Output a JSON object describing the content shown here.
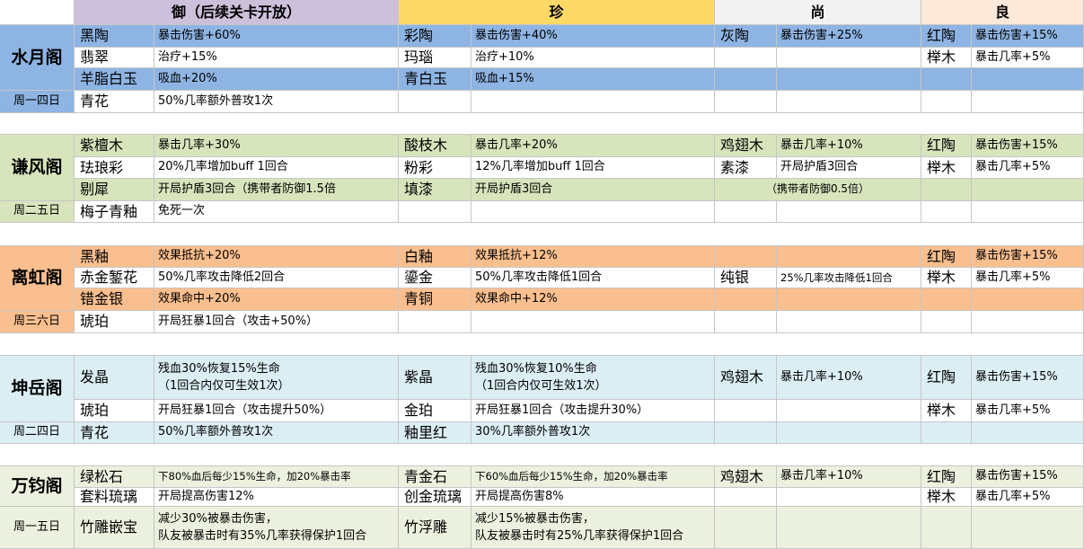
{
  "headers": {
    "yu": "御（后续关卡开放）",
    "zhen": "珍",
    "shang": "尚",
    "liang": "良"
  },
  "colors": {
    "blue_row": "#8eb4e3",
    "green_row": "#d8e4bc",
    "orange_row": "#fabf8f",
    "lightblue_row": "#dbeef4",
    "beige_row": "#ebf1de",
    "yu_header": "#ccc0da",
    "zhen_header": "#ffd966",
    "shang_header": "#f2f2f2",
    "liang_header": "#fde9d9"
  },
  "groups": [
    {
      "name": "水月阁",
      "days": "周一四日",
      "rows": [
        {
          "yu_item": "黑陶",
          "yu_effect": "暴击伤害+60%",
          "zhen_item": "彩陶",
          "zhen_effect": "暴击伤害+40%",
          "shang_item": "灰陶",
          "shang_effect": "暴击伤害+25%",
          "liang_item": "红陶",
          "liang_effect": "暴击伤害+15%"
        },
        {
          "yu_item": "翡翠",
          "yu_effect": "治疗+15%",
          "zhen_item": "玛瑙",
          "zhen_effect": "治疗+10%",
          "shang_item": "",
          "shang_effect": "",
          "liang_item": "榉木",
          "liang_effect": "暴击几率+5%"
        },
        {
          "yu_item": "羊脂白玉",
          "yu_effect": "吸血+20%",
          "zhen_item": "青白玉",
          "zhen_effect": "吸血+15%",
          "shang_item": "",
          "shang_effect": "",
          "liang_item": "",
          "liang_effect": ""
        },
        {
          "yu_item": "青花",
          "yu_effect": "50%几率额外普攻1次",
          "zhen_item": "",
          "zhen_effect": "",
          "shang_item": "",
          "shang_effect": "",
          "liang_item": "",
          "liang_effect": ""
        }
      ]
    },
    {
      "name": "谦风阁",
      "days": "周二五日",
      "rows": [
        {
          "yu_item": "紫檀木",
          "yu_effect": "暴击几率+30%",
          "zhen_item": "酸枝木",
          "zhen_effect": "暴击几率+20%",
          "shang_item": "鸡翅木",
          "shang_effect": "暴击几率+10%",
          "liang_item": "红陶",
          "liang_effect": "暴击伤害+15%"
        },
        {
          "yu_item": "珐琅彩",
          "yu_effect": "20%几率增加buff 1回合",
          "zhen_item": "粉彩",
          "zhen_effect": "12%几率增加buff 1回合",
          "shang_item": "素漆",
          "shang_effect": "开局护盾3回合",
          "liang_item": "榉木",
          "liang_effect": "暴击几率+5%"
        },
        {
          "yu_item": "剔犀",
          "yu_effect": "开局护盾3回合（携带者防御1.5倍",
          "zhen_item": "填漆",
          "zhen_effect": "开局护盾3回合",
          "shang_item": "",
          "shang_effect": "（携带者防御0.5倍）",
          "liang_item": "",
          "liang_effect": ""
        },
        {
          "yu_item": "梅子青釉",
          "yu_effect": "免死一次",
          "zhen_item": "",
          "zhen_effect": "",
          "shang_item": "",
          "shang_effect": "",
          "liang_item": "",
          "liang_effect": ""
        }
      ]
    },
    {
      "name": "离虹阁",
      "days": "周三六日",
      "rows": [
        {
          "yu_item": "黑釉",
          "yu_effect": "效果抵抗+20%",
          "zhen_item": "白釉",
          "zhen_effect": "效果抵抗+12%",
          "shang_item": "",
          "shang_effect": "",
          "liang_item": "红陶",
          "liang_effect": "暴击伤害+15%"
        },
        {
          "yu_item": "赤金錾花",
          "yu_effect": "50%几率攻击降低2回合",
          "zhen_item": "鎏金",
          "zhen_effect": "50%几率攻击降低1回合",
          "shang_item": "纯银",
          "shang_effect": "25%几率攻击降低1回合",
          "liang_item": "榉木",
          "liang_effect": "暴击几率+5%"
        },
        {
          "yu_item": "错金银",
          "yu_effect": "效果命中+20%",
          "zhen_item": "青铜",
          "zhen_effect": "效果命中+12%",
          "shang_item": "",
          "shang_effect": "",
          "liang_item": "",
          "liang_effect": ""
        },
        {
          "yu_item": "琥珀",
          "yu_effect": "开局狂暴1回合（攻击+50%）",
          "zhen_item": "",
          "zhen_effect": "",
          "shang_item": "",
          "shang_effect": "",
          "liang_item": "",
          "liang_effect": ""
        }
      ]
    },
    {
      "name": "坤岳阁",
      "days": "周二四日",
      "rows": [
        {
          "yu_item": "发晶",
          "yu_effect_line1": "残血30%恢复15%生命",
          "yu_effect_line2": "（1回合内仅可生效1次）",
          "zhen_item": "紫晶",
          "zhen_effect_line1": "残血30%恢复10%生命",
          "zhen_effect_line2": "（1回合内仅可生效1次）",
          "shang_item": "鸡翅木",
          "shang_effect": "暴击几率+10%",
          "liang_item": "红陶",
          "liang_effect": "暴击伤害+15%"
        },
        {
          "yu_item": "琥珀",
          "yu_effect": "开局狂暴1回合（攻击提升50%）",
          "zhen_item": "金珀",
          "zhen_effect": "开局狂暴1回合（攻击提升30%）",
          "shang_item": "",
          "shang_effect": "",
          "liang_item": "榉木",
          "liang_effect": "暴击几率+5%"
        },
        {
          "yu_item": "青花",
          "yu_effect": "50%几率额外普攻1次",
          "zhen_item": "釉里红",
          "zhen_effect": "30%几率额外普攻1次",
          "shang_item": "",
          "shang_effect": "",
          "liang_item": "",
          "liang_effect": ""
        }
      ]
    },
    {
      "name": "万钧阁",
      "days": "周一五日",
      "rows": [
        {
          "yu_item": "绿松石",
          "yu_effect": "下80%血后每少15%生命，加20%暴击率",
          "zhen_item": "青金石",
          "zhen_effect": "下60%血后每少15%生命，加20%暴击率",
          "shang_item": "鸡翅木",
          "shang_effect": "暴击几率+10%",
          "liang_item": "红陶",
          "liang_effect": "暴击伤害+15%"
        },
        {
          "yu_item": "套料琉璃",
          "yu_effect": "开局提高伤害12%",
          "zhen_item": "创金琉璃",
          "zhen_effect": "开局提高伤害8%",
          "shang_item": "",
          "shang_effect": "",
          "liang_item": "榉木",
          "liang_effect": "暴击几率+5%"
        },
        {
          "yu_item": "竹雕嵌宝",
          "yu_effect_line1": "减少30%被暴击伤害，",
          "yu_effect_line2": "队友被暴击时有35%几率获得保护1回合",
          "zhen_item": "竹浮雕",
          "zhen_effect_line1": "减少15%被暴击伤害，",
          "zhen_effect_line2": "队友被暴击时有25%几率获得保护1回合",
          "shang_item": "",
          "shang_effect": "",
          "liang_item": "",
          "liang_effect": ""
        }
      ]
    }
  ]
}
